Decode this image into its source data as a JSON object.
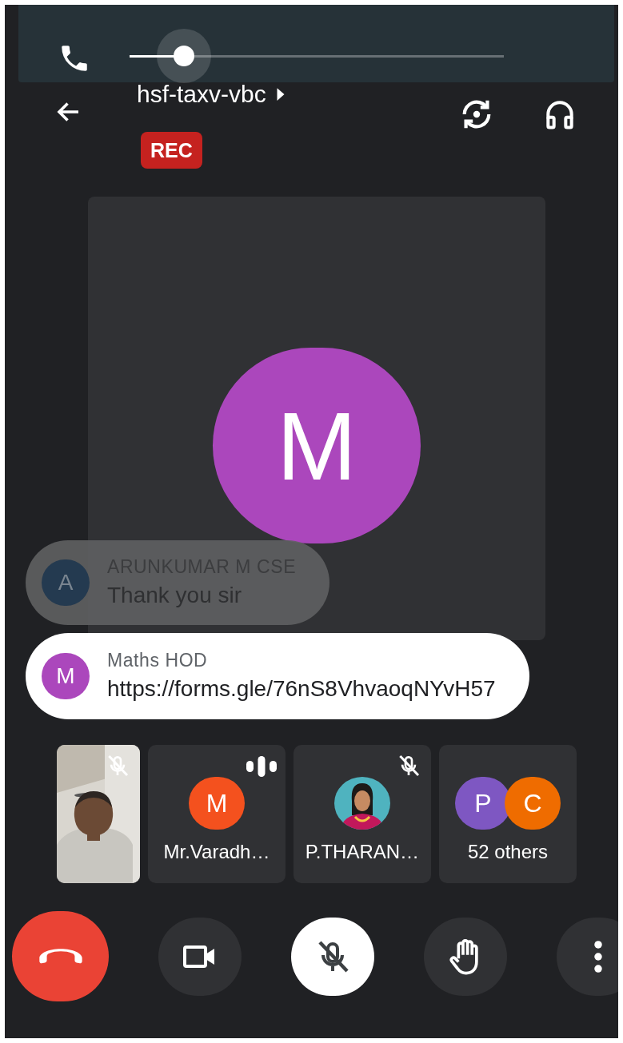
{
  "volume": {
    "level": 0.145
  },
  "header": {
    "title": "hsf-taxv-vbc",
    "rec_badge": "REC"
  },
  "main_tile": {
    "avatar_letter": "M",
    "color": "#ab47bc"
  },
  "chat_messages": [
    {
      "sender": "ARUNKUMAR M CSE",
      "text": "Thank you sir",
      "avatar_letter": "A",
      "color": "#243a50",
      "faded": true
    },
    {
      "sender": "Maths HOD",
      "text": "https://forms.gle/76nS8VhvaoqNYvH57",
      "avatar_letter": "M",
      "color": "#ab47bc",
      "faded": false
    }
  ],
  "participants": [
    {
      "kind": "video",
      "muted": true,
      "speaking": false
    },
    {
      "kind": "avatar",
      "name": "Mr.Varadh…",
      "letter": "M",
      "color": "#f4511e",
      "muted": false,
      "speaking": true
    },
    {
      "name": "P.THARAN…",
      "muted": true,
      "speaking": false
    },
    {
      "kind": "group",
      "label": "52 others",
      "avatars": [
        {
          "letter": "P",
          "color": "#7e57c2"
        },
        {
          "letter": "C",
          "color": "#ef6c00"
        }
      ]
    }
  ],
  "controls": [
    {
      "kind": "end-call"
    },
    {
      "kind": "camera"
    },
    {
      "kind": "mic",
      "muted": true
    },
    {
      "kind": "raise-hand"
    },
    {
      "kind": "more"
    }
  ]
}
